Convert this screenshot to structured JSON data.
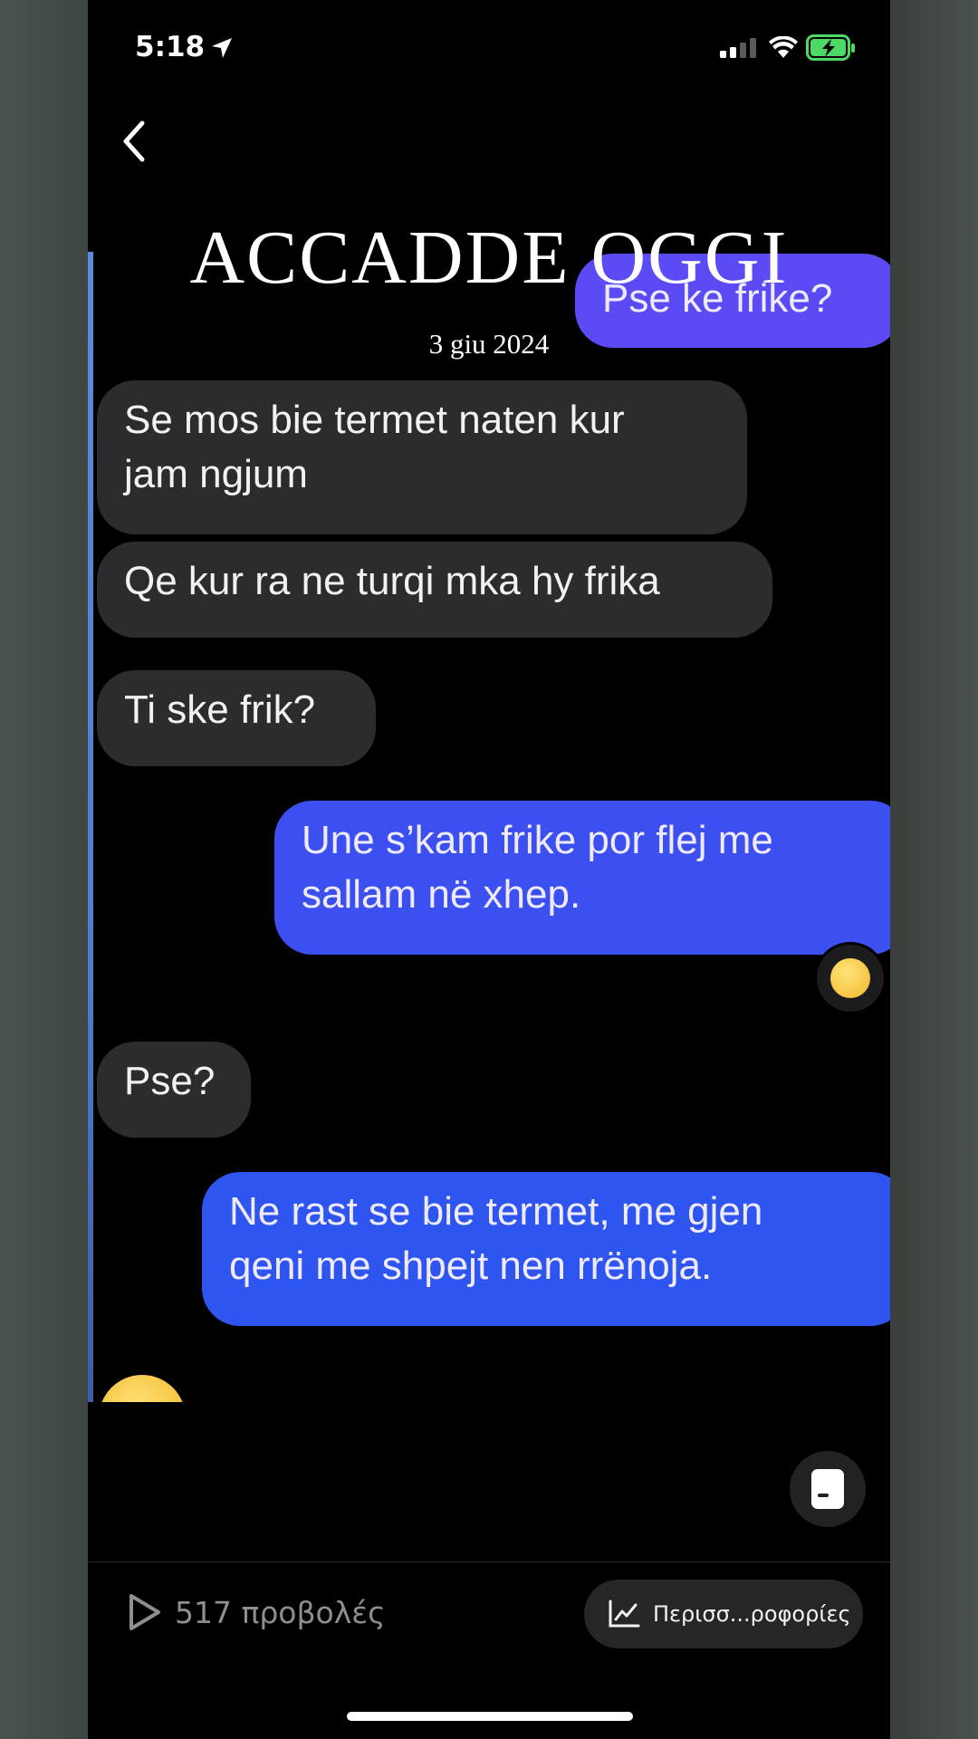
{
  "status_bar": {
    "time": "5:18",
    "icons": [
      "location-arrow-icon",
      "cellular-signal-icon",
      "wifi-icon",
      "battery-charging-icon"
    ],
    "battery_color": "#4cd964"
  },
  "overlay": {
    "title": "ACCADDE OGGI",
    "date": "3 giu 2024"
  },
  "chat": {
    "messages": [
      {
        "direction": "outgoing",
        "text": "Pse ke frike?"
      },
      {
        "direction": "incoming",
        "lines": [
          "Se mos bie termet naten kur",
          "jam ngjum"
        ]
      },
      {
        "direction": "incoming",
        "text": "Qe kur ra ne turqi mka hy frika"
      },
      {
        "direction": "incoming",
        "text": "Ti ske frik?"
      },
      {
        "direction": "outgoing",
        "lines": [
          "Une s’kam frike por flej me",
          "sallam në xhep."
        ],
        "reaction": "laughing-face-emoji"
      },
      {
        "direction": "incoming",
        "text": "Pse?"
      },
      {
        "direction": "outgoing",
        "lines": [
          "Ne rast se bie termet, me gjen",
          "qeni me shpejt  nen rrënoja."
        ]
      }
    ],
    "colors": {
      "incoming_bubble": "#2c2c2e",
      "outgoing_bubble": "#5b4bf5",
      "outgoing_bubble_alt": "#2f55f0"
    }
  },
  "footer": {
    "views": "517 προβολές",
    "more_button": "Περισσ...ροφορίες",
    "caption_icon": "captions-icon",
    "views_icon": "play-icon",
    "insights_icon": "chart-line-icon"
  }
}
